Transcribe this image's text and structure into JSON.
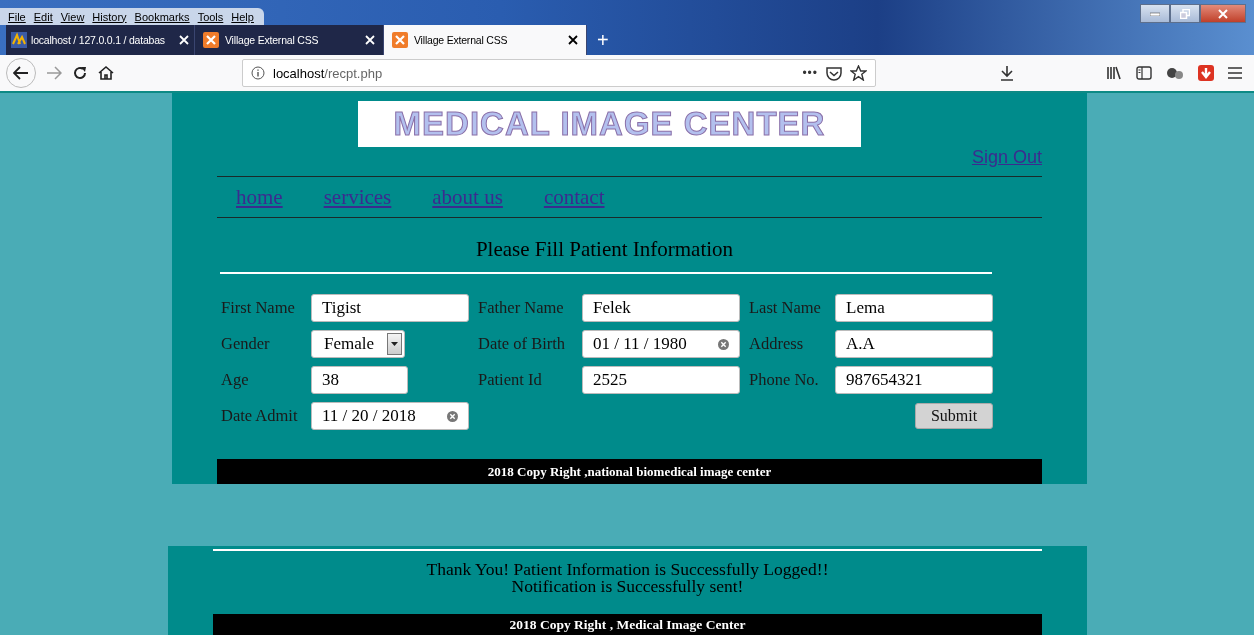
{
  "browser": {
    "menu": [
      "File",
      "Edit",
      "View",
      "History",
      "Bookmarks",
      "Tools",
      "Help"
    ],
    "tabs": [
      {
        "title": "localhost / 127.0.0.1 / databas",
        "selected": false,
        "kind": "db"
      },
      {
        "title": "Village External CSS",
        "selected": false,
        "kind": "xampp"
      },
      {
        "title": "Village External CSS",
        "selected": true,
        "kind": "xampp"
      }
    ],
    "new_tab": "+",
    "address": {
      "host": "localhost",
      "path": "/recpt.php"
    },
    "more": "•••"
  },
  "header": {
    "logo": "MEDICAL IMAGE CENTER",
    "sign_out": "Sign Out"
  },
  "nav": [
    "home",
    "services",
    "about us",
    "contact"
  ],
  "form": {
    "title": "Please Fill Patient Information",
    "rows": [
      [
        {
          "label": "First Name",
          "value": "Tigist",
          "kind": "text"
        },
        {
          "label": "Father Name",
          "value": "Felek",
          "kind": "text"
        },
        {
          "label": "Last Name",
          "value": "Lema",
          "kind": "text"
        }
      ],
      [
        {
          "label": "Gender",
          "value": "Female",
          "kind": "select"
        },
        {
          "label": "Date of Birth",
          "value": "01 / 11 / 1980",
          "kind": "date"
        },
        {
          "label": "Address",
          "value": "A.A",
          "kind": "text"
        }
      ],
      [
        {
          "label": "Age",
          "value": "38",
          "kind": "short"
        },
        {
          "label": "Patient Id",
          "value": "2525",
          "kind": "text"
        },
        {
          "label": "Phone No.",
          "value": "987654321",
          "kind": "text"
        }
      ],
      [
        {
          "label": "Date Admit",
          "value": "11 / 20 / 2018",
          "kind": "date"
        }
      ]
    ],
    "submit": "Submit"
  },
  "footer_top": "2018 Copy Right ,national biomedical image center",
  "message": [
    "Thank You! Patient Information is Successfully Logged!!",
    "Notification is Successfully sent!"
  ],
  "footer_bottom": "2018 Copy Right , Medical Image Center"
}
